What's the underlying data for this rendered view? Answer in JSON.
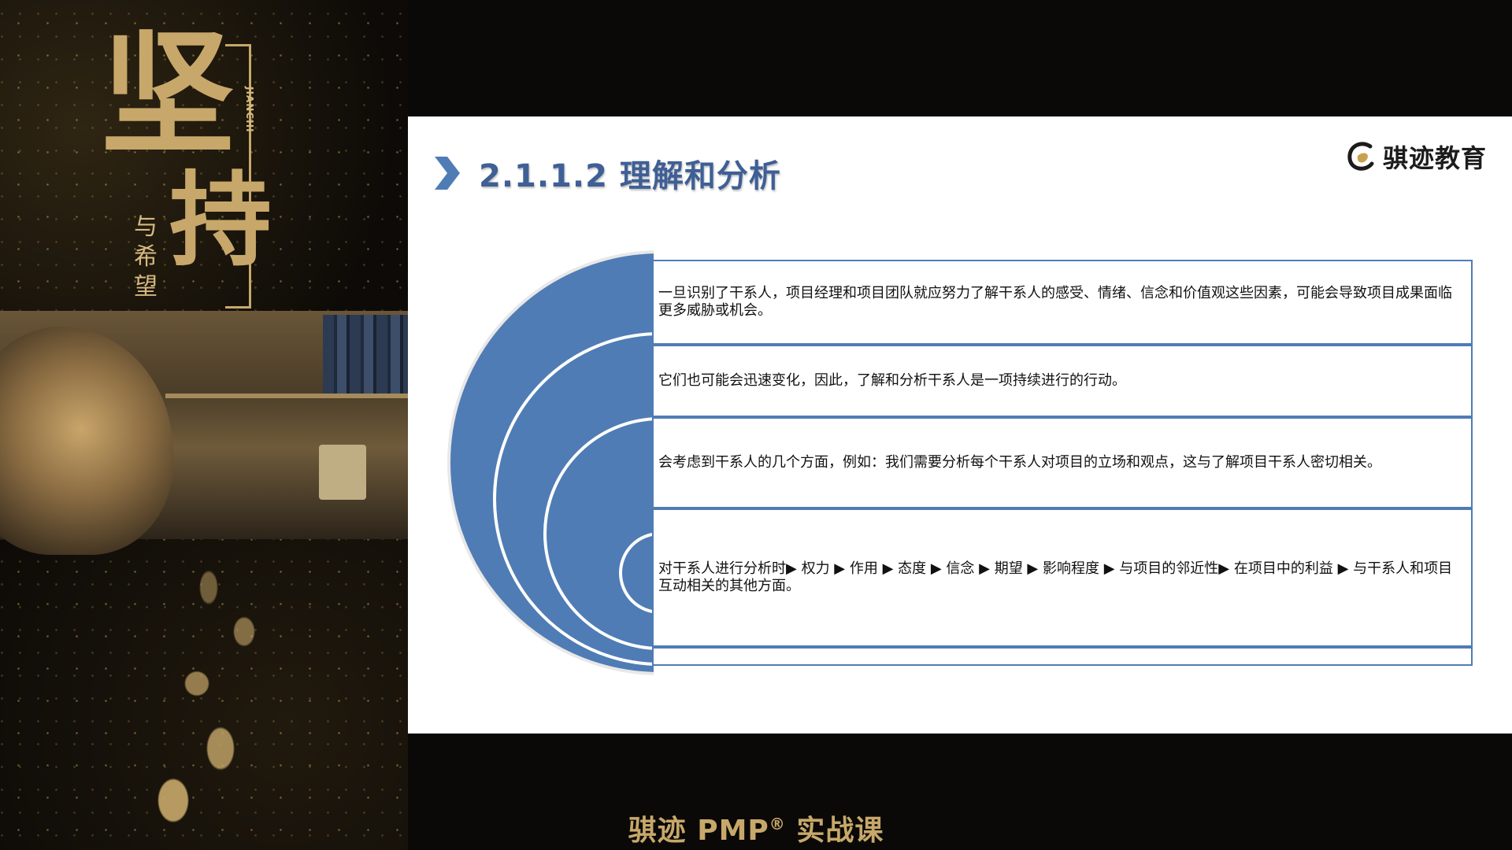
{
  "poster": {
    "title_char_1": "坚",
    "title_char_2": "持",
    "subtitle": "与希望",
    "pinyin": "JIANCHI"
  },
  "slide": {
    "section_title": "2.1.1.2 理解和分析",
    "brand_name": "骐迹教育",
    "accent_color": "#4f7cb5",
    "title_color": "#3f5f95",
    "rows": [
      {
        "text": "一旦识别了干系人，项目经理和项目团队就应努力了解干系人的感受、情绪、信念和价值观这些因素，可能会导致项目成果面临更多威胁或机会。"
      },
      {
        "text": "它们也可能会迅速变化，因此，了解和分析干系人是一项持续进行的行动。"
      },
      {
        "text": "会考虑到干系人的几个方面，例如：我们需要分析每个干系人对项目的立场和观点，这与了解项目干系人密切相关。"
      },
      {
        "text": "对干系人进行分析时▶ 权力 ▶ 作用 ▶ 态度 ▶ 信念 ▶ 期望 ▶ 影响程度 ▶ 与项目的邻近性▶ 在项目中的利益 ▶ 与干系人和项目互动相关的其他方面。"
      }
    ]
  },
  "caption": {
    "prefix": "骐迹 PMP",
    "registered": "®",
    "suffix": " 实战课"
  }
}
